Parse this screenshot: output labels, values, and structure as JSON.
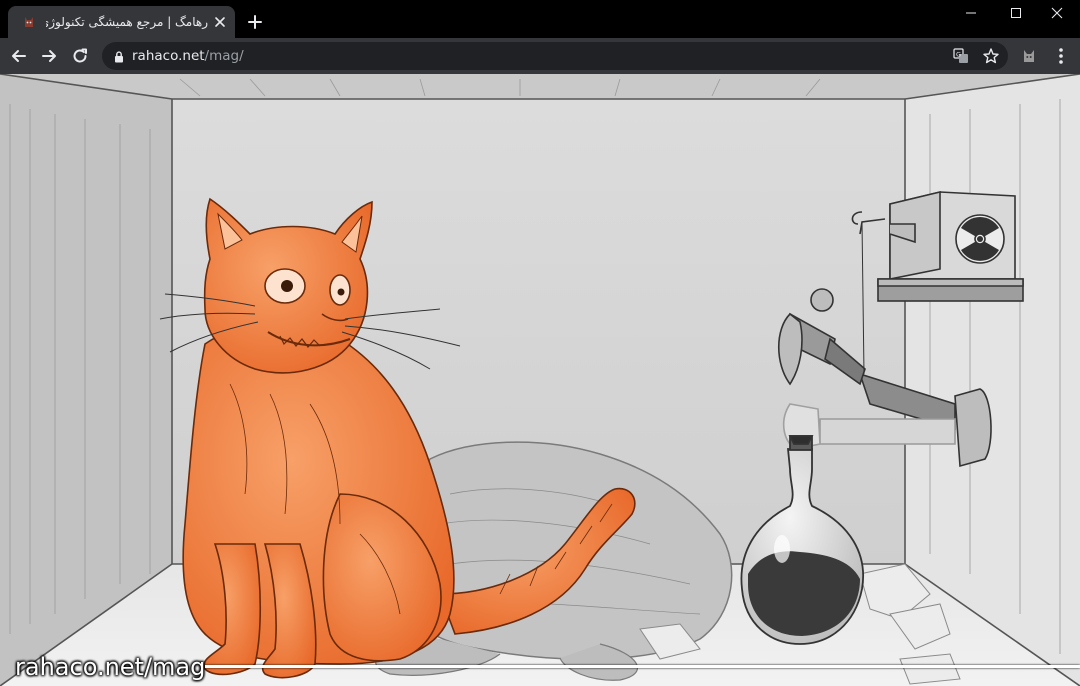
{
  "browser": {
    "tab": {
      "title": "رهامگ | مرجع همیشگی تکنولوژی |",
      "favicon": "rahaco-favicon-icon"
    },
    "new_tab_icon": "plus-icon",
    "window_controls": {
      "minimize": "minimize-icon",
      "maximize": "maximize-icon",
      "close": "close-icon"
    },
    "toolbar": {
      "back": "arrow-left-icon",
      "forward": "arrow-right-icon",
      "reload": "reload-icon",
      "url_host": "rahaco.net",
      "url_path": "/mag/",
      "lock": "lock-icon",
      "translate": "translate-icon",
      "bookmark": "star-icon",
      "extension": "extension-icon",
      "menu": "kebab-menu-icon"
    }
  },
  "content": {
    "watermark": "rahaco.net/mag"
  },
  "colors": {
    "tabstrip": "#000000",
    "toolbar": "#35363a",
    "omnibox": "#202124",
    "cat_orange": "#f07a2e",
    "room_gray": "#d9d9d9"
  }
}
